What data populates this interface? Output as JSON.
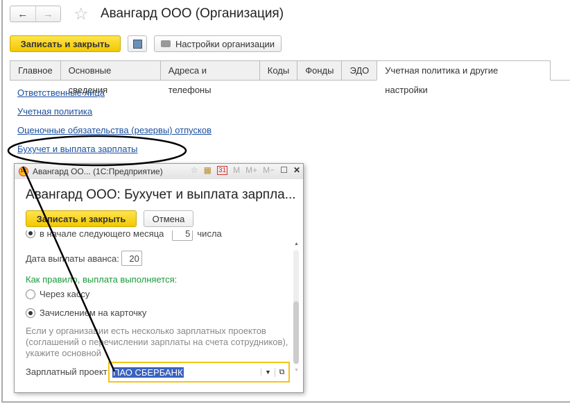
{
  "window": {
    "title": "Авангард ООО (Организация)"
  },
  "toolbar": {
    "save_close": "Записать и закрыть",
    "settings": "Настройки организации"
  },
  "tabs": [
    "Главное",
    "Основные сведения",
    "Адреса и телефоны",
    "Коды",
    "Фонды",
    "ЭДО",
    "Учетная политика и другие настройки"
  ],
  "links": [
    "Ответственные лица",
    "Учетная политика",
    "Оценочные обязательства (резервы) отпусков",
    "Бухучет и выплата зарплаты"
  ],
  "popup": {
    "titlebar": "Авангард ОО...  (1С:Предприятие)",
    "title_icons": {
      "calendar": "31",
      "m": "M",
      "mplus": "M+",
      "mminus": "M−"
    },
    "heading": "Авангард ООО: Бухучет и выплата зарпла...",
    "save_close": "Записать и закрыть",
    "cancel": "Отмена",
    "month_option": "в начале следующего месяца",
    "month_day": "5",
    "month_suffix": "числа",
    "advance_label": "Дата выплаты аванса:",
    "advance_day": "20",
    "payment_label": "Как правило, выплата выполняется:",
    "option_cash": "Через кассу",
    "option_card": "Зачислением на карточку",
    "note": "Если у организации есть несколько зарплатных проектов (соглашений о перечислении зарплаты на счета сотрудников), укажите основной",
    "project_label": "Зарплатный проект:",
    "project_value": "ПАО СБЕРБАНК"
  }
}
